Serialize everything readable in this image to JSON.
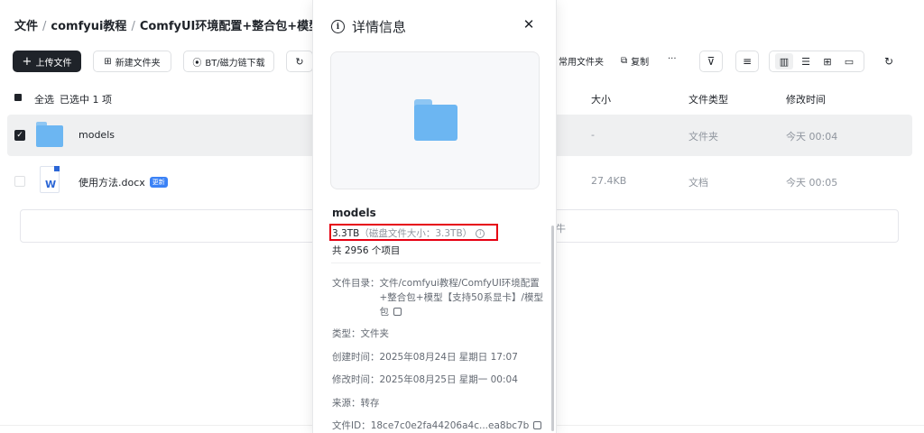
{
  "breadcrumb": [
    "文件",
    "comfyui教程",
    "ComfyUI环境配置+整合包+模型【支"
  ],
  "toolbar": {
    "upload": "上传文件",
    "new_folder": "新建文件夹",
    "bt_download": "BT/磁力链下载",
    "common_folder": "常用文件夹",
    "copy": "复制",
    "more": "···"
  },
  "list_header": {
    "select_all": "全选",
    "selected_info": "已选中 1 项",
    "size": "大小",
    "type": "文件类型",
    "modified": "修改时间"
  },
  "rows": [
    {
      "name": "models",
      "size": "-",
      "type": "文件夹",
      "modified": "今天 00:04",
      "selected": true
    },
    {
      "name": "使用方法.docx",
      "badge": "更新",
      "size": "27.4KB",
      "type": "文档",
      "modified": "今天 00:05",
      "selected": false
    }
  ],
  "hidden_row_fragment": "牛",
  "details": {
    "title": "详情信息",
    "name": "models",
    "size_main": "3.3TB",
    "size_disk": "（磁盘文件大小：3.3TB）",
    "count": "共 2956 个项目",
    "dir_label": "文件目录：",
    "dir_value": "文件/comfyui教程/ComfyUI环境配置+整合包+模型【支持50系显卡】/模型包",
    "type_label": "类型：",
    "type_value": "文件夹",
    "created_label": "创建时间：",
    "created_value": "2025年08月24日 星期日 17:07",
    "modified_label": "修改时间：",
    "modified_value": "2025年08月25日 星期一 00:04",
    "source_label": "来源：",
    "source_value": "转存",
    "id_label": "文件ID：",
    "id_value": "18ce7c0e2fa44206a4c...ea8bc7b"
  },
  "colors": {
    "highlight_box": "#e60012",
    "folder": "#6cb6f2",
    "badge": "#3b82f6"
  }
}
